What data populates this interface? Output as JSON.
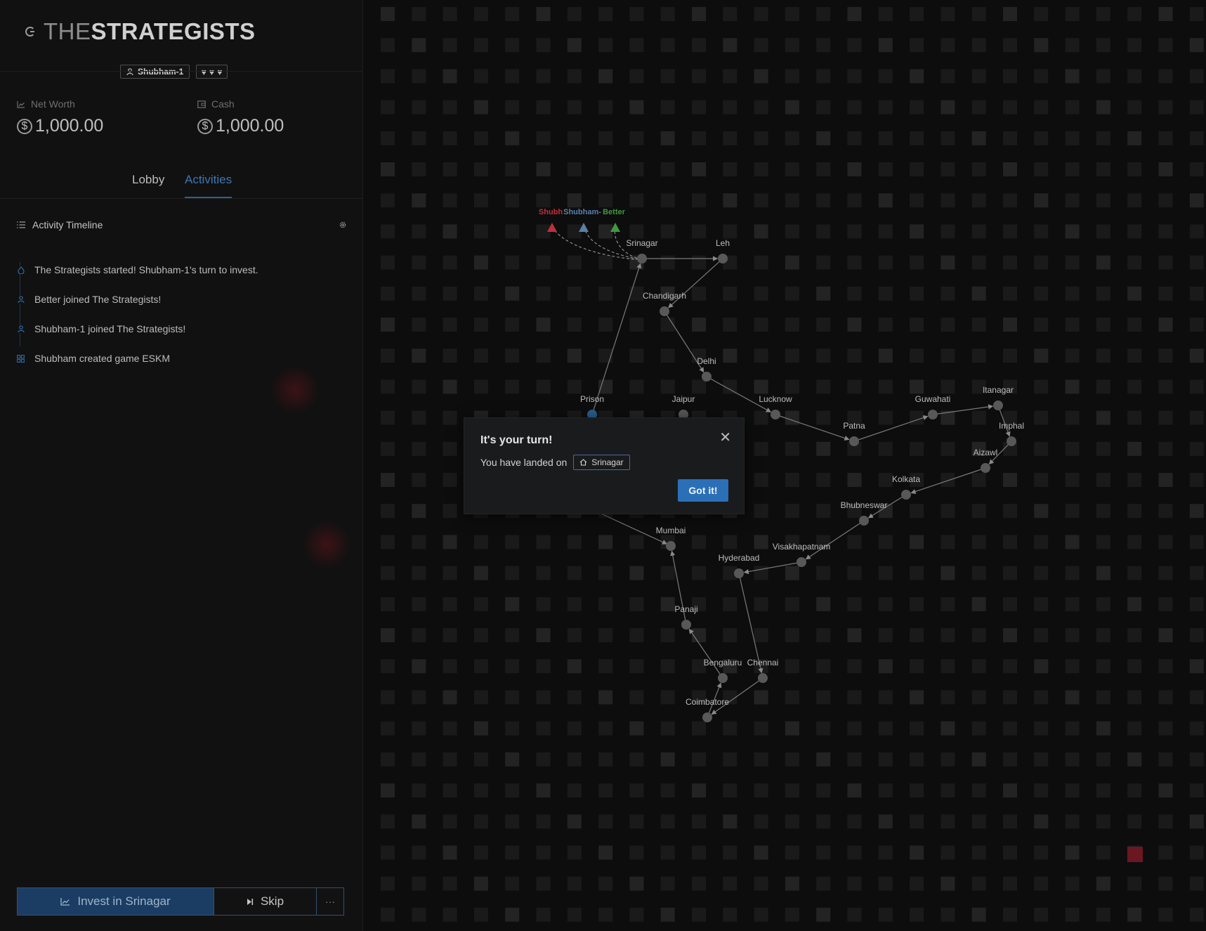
{
  "header": {
    "logo_light": "THE",
    "logo_bold": "STRATEGISTS",
    "player_name": "Shubham-1",
    "hearts": "♥ ♥ ♥"
  },
  "stats": {
    "net_worth_label": "Net Worth",
    "net_worth_value": "1,000.00",
    "cash_label": "Cash",
    "cash_value": "1,000.00",
    "currency_symbol": "$"
  },
  "tabs": [
    {
      "label": "Lobby"
    },
    {
      "label": "Activities",
      "active": true
    }
  ],
  "timeline": {
    "title": "Activity Timeline",
    "items": [
      {
        "icon": "flag-icon",
        "text": "The Strategists started! Shubham-1's turn to invest."
      },
      {
        "icon": "user-icon",
        "text": "Better joined The Strategists!"
      },
      {
        "icon": "user-icon",
        "text": "Shubham-1 joined The Strategists!"
      },
      {
        "icon": "grid-icon",
        "text": "Shubham created game ESKM"
      }
    ]
  },
  "actions": {
    "invest_label": "Invest in Srinagar",
    "skip_label": "Skip",
    "more_label": "···"
  },
  "board": {
    "players": [
      {
        "name": "Shubh",
        "color": "#c0303c"
      },
      {
        "name": "Shubham-",
        "color": "#5a7fa8"
      },
      {
        "name": "Better",
        "color": "#3f9a3f"
      }
    ],
    "cities": [
      "Srinagar",
      "Leh",
      "Chandigarh",
      "Delhi",
      "Prison",
      "Jaipur",
      "Lucknow",
      "Patna",
      "Guwahati",
      "Itanagar",
      "Imphal",
      "Aizawl",
      "Kolkata",
      "Bhubneswar",
      "Visakhapatnam",
      "Hyderabad",
      "Mumbai",
      "Panaji",
      "Bengaluru",
      "Chennai",
      "Coimbatore"
    ]
  },
  "modal": {
    "title": "It's your turn!",
    "body": "You have landed on",
    "location": "Srinagar",
    "button": "Got it!"
  },
  "colors": {
    "accent": "#2b6fb7",
    "panel": "#111111",
    "background": "#0d0d0d"
  }
}
